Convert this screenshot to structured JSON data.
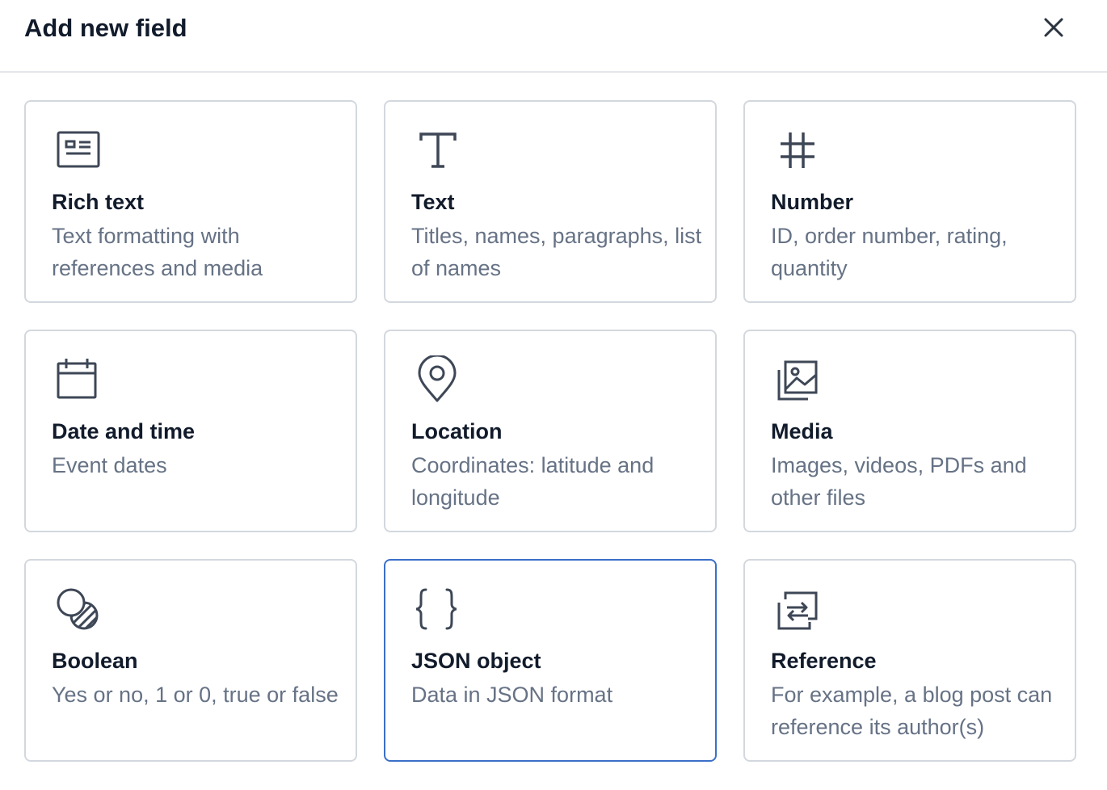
{
  "dialog": {
    "title": "Add new field",
    "close_icon": "close-icon"
  },
  "cards": [
    {
      "name": "Rich text",
      "description": "Text formatting with references and media",
      "icon": "rich-text-icon"
    },
    {
      "name": "Text",
      "description": "Titles, names, paragraphs, list of names",
      "icon": "text-icon"
    },
    {
      "name": "Number",
      "description": "ID, order number, rating, quantity",
      "icon": "number-icon"
    },
    {
      "name": "Date and time",
      "description": "Event dates",
      "icon": "calendar-icon"
    },
    {
      "name": "Location",
      "description": "Coordinates: latitude and longitude",
      "icon": "location-pin-icon"
    },
    {
      "name": "Media",
      "description": "Images, videos, PDFs and other files",
      "icon": "media-icon"
    },
    {
      "name": "Boolean",
      "description": "Yes or no, 1 or 0, true or false",
      "icon": "boolean-icon"
    },
    {
      "name": "JSON object",
      "description": "Data in JSON format",
      "icon": "json-braces-icon",
      "selected": true
    },
    {
      "name": "Reference",
      "description": "For example, a blog post can reference its author(s)",
      "icon": "reference-arrows-icon"
    }
  ],
  "colors": {
    "title": "#111b2b",
    "description": "#667285",
    "card_border": "#d3d8de",
    "selected_border": "#3b6fc9",
    "icon": "#3e4756"
  }
}
